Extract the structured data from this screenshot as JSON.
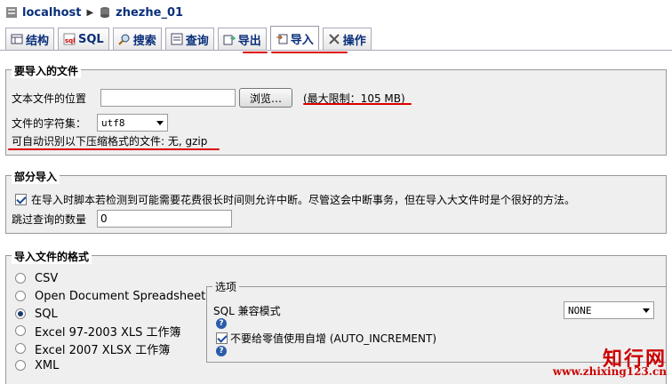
{
  "breadcrumb": {
    "server": "localhost",
    "database": "zhezhe_01"
  },
  "tabs": [
    {
      "label": "结构",
      "icon": "structure-icon"
    },
    {
      "label": "SQL",
      "icon": "sql-icon"
    },
    {
      "label": "搜索",
      "icon": "search-icon"
    },
    {
      "label": "查询",
      "icon": "query-icon"
    },
    {
      "label": "导出",
      "icon": "export-icon"
    },
    {
      "label": "导入",
      "icon": "import-icon",
      "active": true
    },
    {
      "label": "操作",
      "icon": "operations-icon"
    }
  ],
  "file_section": {
    "legend": "要导入的文件",
    "location_label": "文本文件的位置",
    "location_value": "",
    "browse_label": "浏览…",
    "max_limit": "(最大限制：105 MB)",
    "charset_label": "文件的字符集：",
    "charset_value": "utf8",
    "compression_note": "可自动识别以下压缩格式的文件: 无, gzip"
  },
  "partial_section": {
    "legend": "部分导入",
    "interrupt_label": "在导入时脚本若检测到可能需要花费很长时间则允许中断。尽管这会中断事务，但在导入大文件时是个很好的方法。",
    "interrupt_checked": true,
    "skip_label": "跳过查询的数量",
    "skip_value": "0"
  },
  "format_section": {
    "legend": "导入文件的格式",
    "formats": [
      {
        "label": "CSV",
        "selected": false
      },
      {
        "label": "Open Document Spreadsheet",
        "selected": false
      },
      {
        "label": "SQL",
        "selected": true
      },
      {
        "label": "Excel 97-2003 XLS 工作簿",
        "selected": false
      },
      {
        "label": "Excel 2007 XLSX 工作簿",
        "selected": false
      },
      {
        "label": "XML",
        "selected": false
      }
    ],
    "options": {
      "legend": "选项",
      "compat_label": "SQL 兼容模式",
      "compat_value": "NONE",
      "auto_inc_label": "不要给零值使用自增 (AUTO_INCREMENT)",
      "auto_inc_checked": true
    }
  },
  "watermark": {
    "title": "知行网",
    "url": "www.zhixing123.cn"
  },
  "colors": {
    "highlight": "#dd0000",
    "link": "#0a2f7a"
  }
}
